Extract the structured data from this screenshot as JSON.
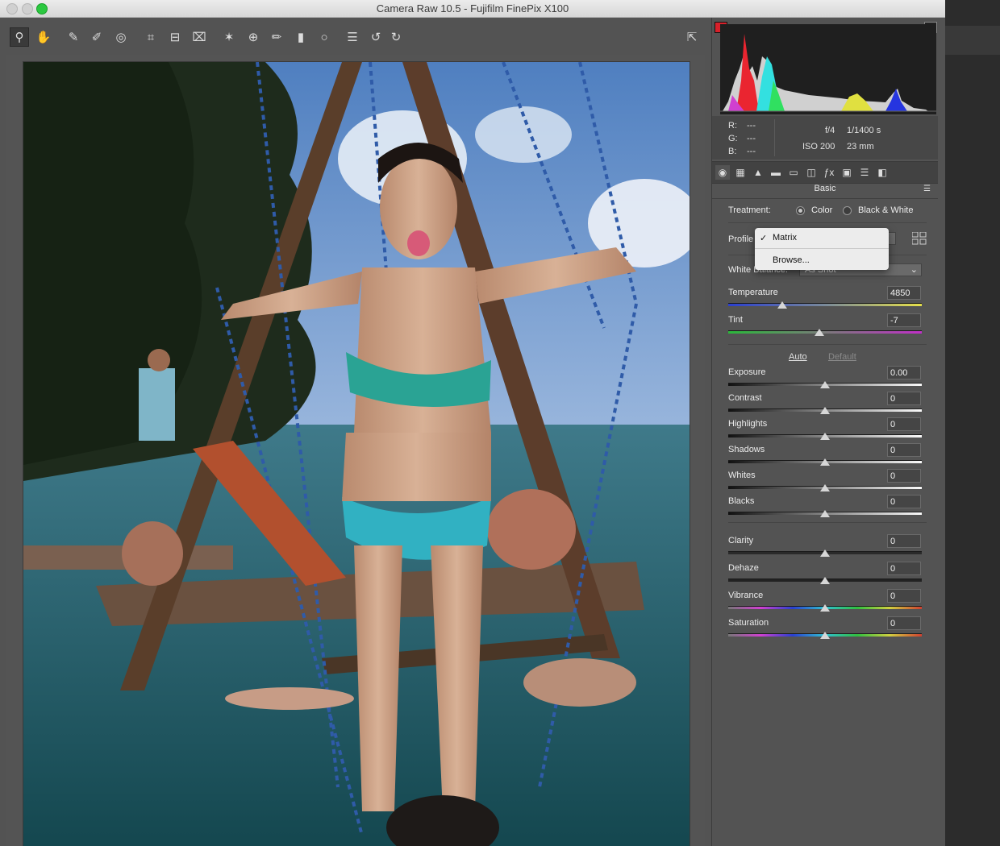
{
  "window": {
    "title": "Camera Raw 10.5  -  Fujifilm FinePix X100"
  },
  "toolbar": {
    "tools": [
      {
        "name": "zoom-icon",
        "glyph": "⚲"
      },
      {
        "name": "hand-icon",
        "glyph": "✋"
      },
      {
        "name": "white-balance-icon",
        "glyph": "✎"
      },
      {
        "name": "color-sampler-icon",
        "glyph": "✐"
      },
      {
        "name": "targeted-adjustment-icon",
        "glyph": "◎"
      },
      {
        "name": "crop-icon",
        "glyph": "⌗"
      },
      {
        "name": "straighten-icon",
        "glyph": "⊟"
      },
      {
        "name": "transform-icon",
        "glyph": "⌧"
      },
      {
        "name": "spot-removal-icon",
        "glyph": "✶"
      },
      {
        "name": "red-eye-icon",
        "glyph": "⊕"
      },
      {
        "name": "adjustment-brush-icon",
        "glyph": "✏"
      },
      {
        "name": "graduated-filter-icon",
        "glyph": "▮"
      },
      {
        "name": "radial-filter-icon",
        "glyph": "○"
      },
      {
        "name": "presets-list-icon",
        "glyph": "☰"
      },
      {
        "name": "rotate-left-icon",
        "glyph": "↺"
      },
      {
        "name": "rotate-right-icon",
        "glyph": "↻"
      }
    ],
    "export_icon": "⇱"
  },
  "info": {
    "r_label": "R:",
    "r_value": "---",
    "g_label": "G:",
    "g_value": "---",
    "b_label": "B:",
    "b_value": "---",
    "aperture": "f/4",
    "shutter": "1/1400 s",
    "iso": "ISO 200",
    "focal_length": "23 mm"
  },
  "panel_tabs": [
    "◉",
    "▦",
    "▲",
    "▬",
    "▭",
    "◫",
    "ƒx",
    "▣",
    "☰",
    "◧"
  ],
  "basic": {
    "section_title": "Basic",
    "treatment_label": "Treatment:",
    "color_label": "Color",
    "bw_label": "Black & White",
    "profile_label": "Profile",
    "white_balance_label": "White Balance:",
    "white_balance_value": "As Shot",
    "temperature_label": "Temperature",
    "temperature_value": "4850",
    "temperature_pos": 0.28,
    "tint_label": "Tint",
    "tint_value": "-7",
    "tint_pos": 0.47,
    "auto_label": "Auto",
    "default_label": "Default",
    "sliders": [
      {
        "label": "Exposure",
        "value": "0.00"
      },
      {
        "label": "Contrast",
        "value": "0"
      },
      {
        "label": "Highlights",
        "value": "0"
      },
      {
        "label": "Shadows",
        "value": "0"
      },
      {
        "label": "Whites",
        "value": "0"
      },
      {
        "label": "Blacks",
        "value": "0"
      },
      {
        "label": "Clarity",
        "value": "0"
      },
      {
        "label": "Dehaze",
        "value": "0"
      },
      {
        "label": "Vibrance",
        "value": "0"
      },
      {
        "label": "Saturation",
        "value": "0"
      }
    ]
  },
  "profile_menu": {
    "items": [
      {
        "label": "Matrix",
        "checked": true
      },
      {
        "label": "Browse...",
        "checked": false
      }
    ]
  },
  "colors": {
    "accent_red": "#d8202a",
    "panel_bg": "#535353"
  }
}
